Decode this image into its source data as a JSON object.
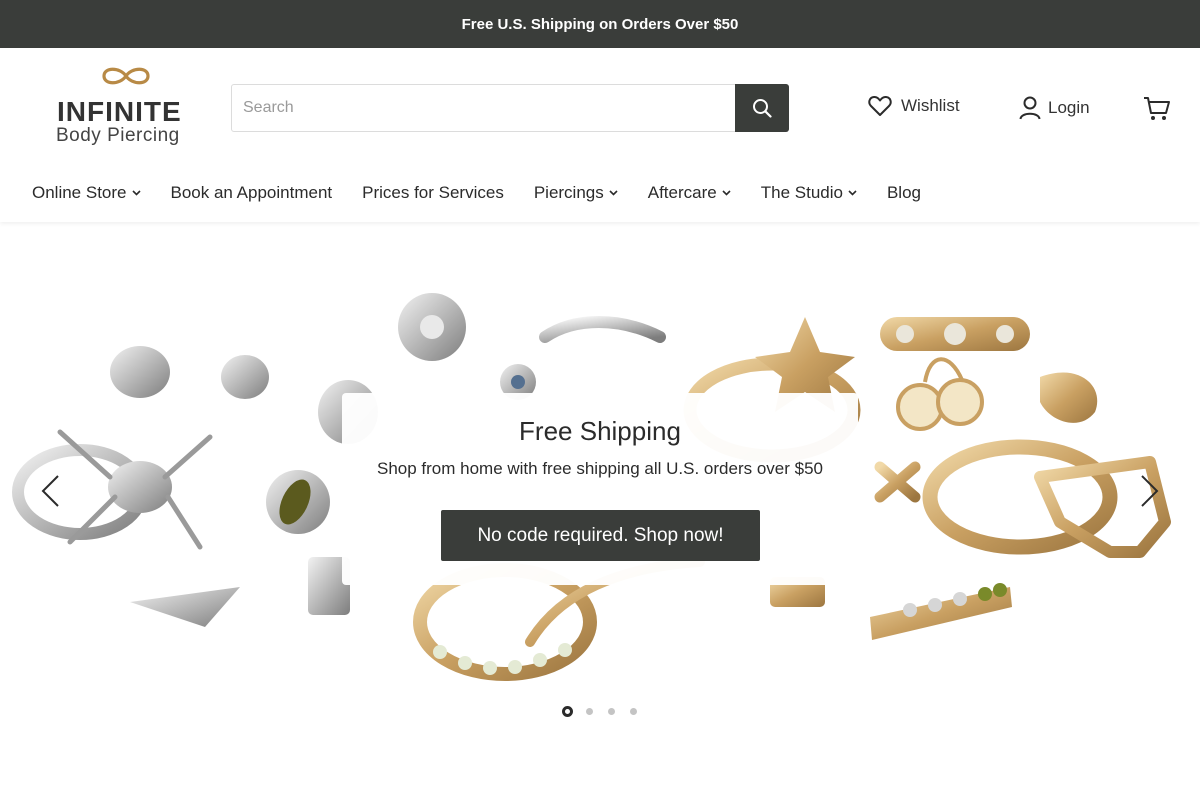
{
  "announcement": {
    "text": "Free U.S. Shipping on Orders Over $50"
  },
  "logo": {
    "brand": "INFINITE",
    "tagline": "Body Piercing",
    "mark_color": "#b88a46"
  },
  "search": {
    "placeholder": "Search",
    "value": "",
    "icon": "search-icon"
  },
  "header_links": {
    "wishlist": "Wishlist",
    "login": "Login",
    "cart_icon": "cart-icon"
  },
  "nav": {
    "items": [
      {
        "label": "Online Store",
        "has_dropdown": true
      },
      {
        "label": "Book an Appointment",
        "has_dropdown": false
      },
      {
        "label": "Prices for Services",
        "has_dropdown": false
      },
      {
        "label": "Piercings",
        "has_dropdown": true
      },
      {
        "label": "Aftercare",
        "has_dropdown": true
      },
      {
        "label": "The Studio",
        "has_dropdown": true
      },
      {
        "label": "Blog",
        "has_dropdown": false
      }
    ]
  },
  "hero": {
    "title": "Free Shipping",
    "subtitle": "Shop from home with free shipping all U.S. orders over $50",
    "cta": "No code required. Shop now!",
    "slides_total": 4,
    "active_slide": 1
  },
  "colors": {
    "dark": "#3a3d3a",
    "gold": "#c9a062",
    "silver": "#b8b8b8",
    "accent_brand": "#b88a46"
  }
}
